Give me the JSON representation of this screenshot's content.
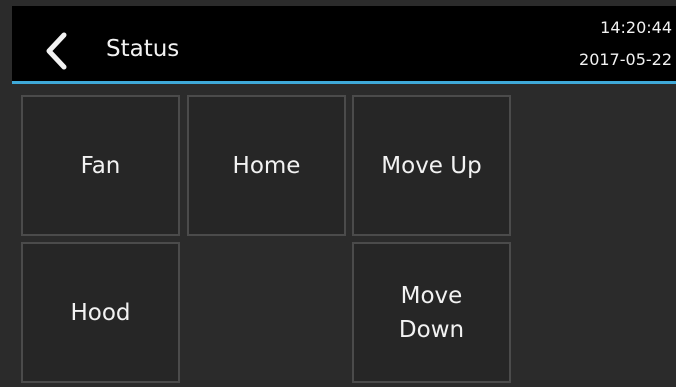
{
  "header": {
    "title": "Status",
    "back_icon": "chevron-left-icon",
    "time": "14:20:44",
    "date": "2017-05-22"
  },
  "buttons": {
    "fan": "Fan",
    "home": "Home",
    "move_up": "Move Up",
    "hood": "Hood",
    "move_down_line1": "Move",
    "move_down_line2": "Down"
  },
  "colors": {
    "header_bg": "#000000",
    "accent": "#3fa9d8",
    "background": "#2b2b2b",
    "tile_border": "#4b4b4b",
    "text": "#f2f2f2"
  }
}
